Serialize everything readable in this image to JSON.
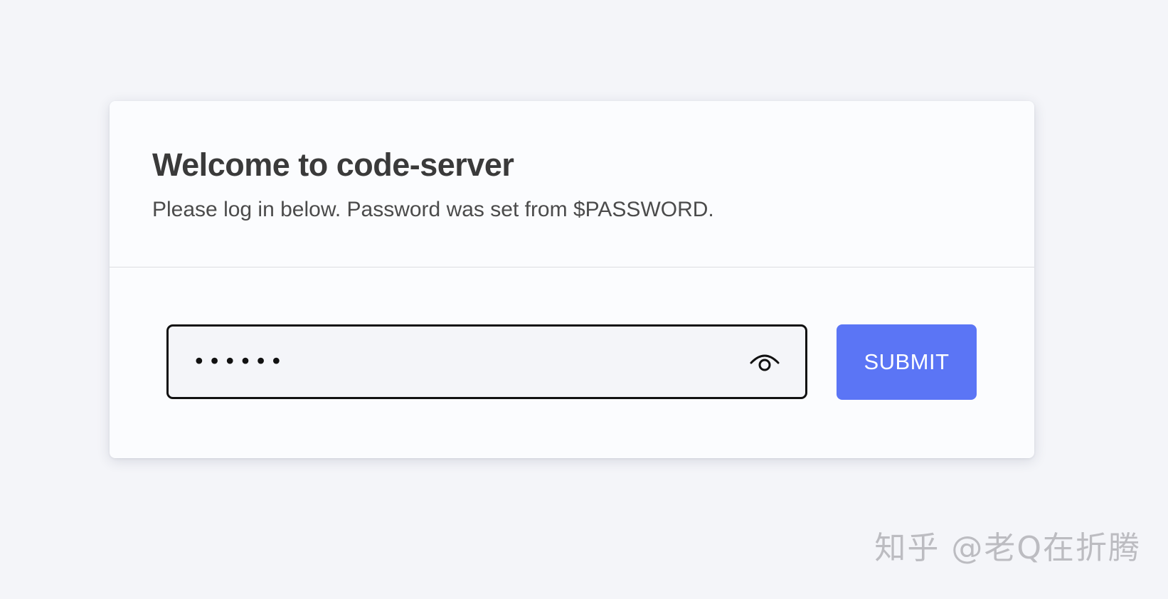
{
  "login": {
    "title": "Welcome to code-server",
    "subtitle": "Please log in below. Password was set from $PASSWORD.",
    "password_value": "••••••",
    "submit_label": "SUBMIT"
  },
  "icons": {
    "visibility_toggle": "eye-icon"
  },
  "colors": {
    "page_background": "#f4f5f9",
    "card_background": "#fbfcfe",
    "accent": "#5b75f5",
    "input_border": "#111111"
  },
  "watermark": {
    "text": "知乎 @老Q在折腾"
  }
}
